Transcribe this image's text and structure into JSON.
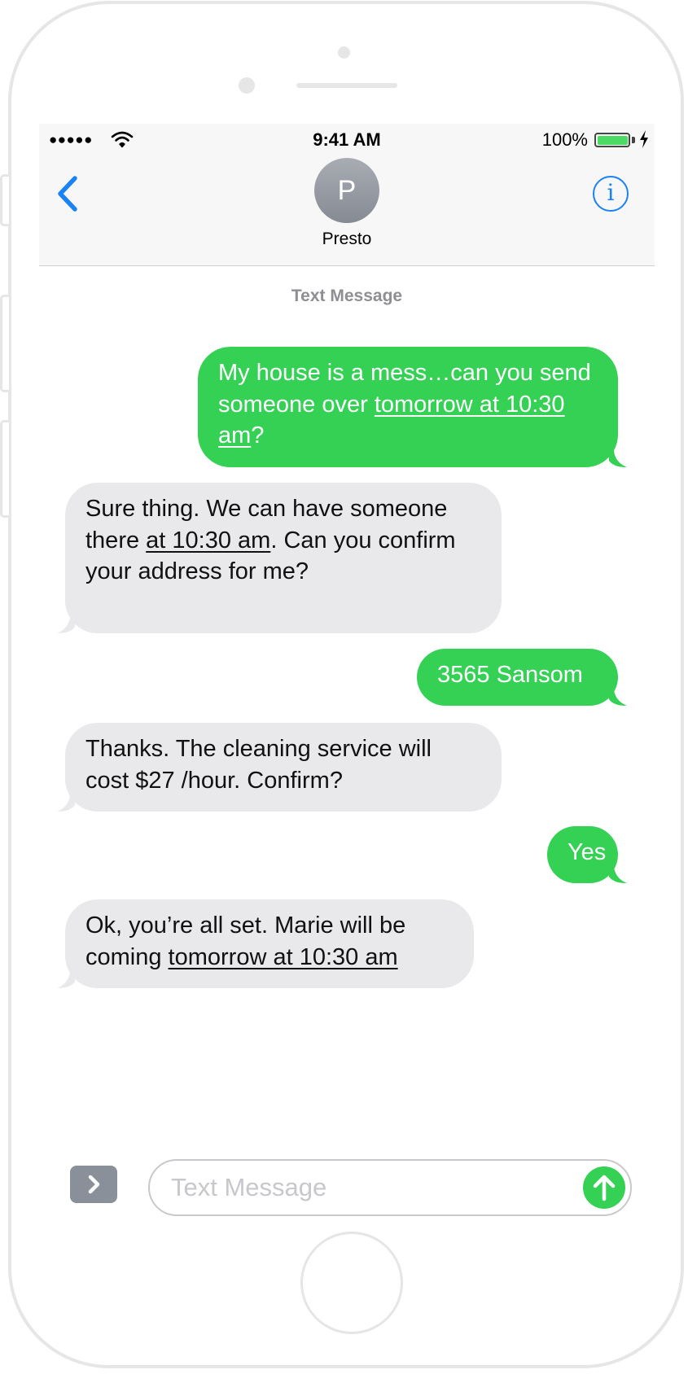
{
  "status_bar": {
    "signal": "●●●●●",
    "time": "9:41 AM",
    "battery": "100%",
    "signal_icon": "signal-dots-icon",
    "wifi_icon": "wifi-icon",
    "battery_icon": "battery-full-icon",
    "charging_icon": "charging-bolt-icon"
  },
  "header": {
    "back_icon": "chevron-left-icon",
    "avatar_initial": "P",
    "contact_name": "Presto",
    "info_icon": "info-circle-icon",
    "info_glyph": "i"
  },
  "thread": {
    "label": "Text Message",
    "messages": [
      {
        "direction": "sent",
        "parts": [
          "My house is a mess…can you send someone over ",
          "tomorrow at 10:30 am",
          "?"
        ],
        "links": [
          1
        ]
      },
      {
        "direction": "received",
        "parts": [
          "Sure thing.  We can have someone there ",
          "at 10:30 am",
          ".  Can you confirm your address for me?"
        ],
        "links": [
          1
        ]
      },
      {
        "direction": "sent",
        "parts": [
          "3565 Sansom"
        ],
        "links": []
      },
      {
        "direction": "received",
        "parts": [
          "Thanks. The cleaning service will cost $27 /hour.  Confirm?"
        ],
        "links": []
      },
      {
        "direction": "sent",
        "parts": [
          "Yes"
        ],
        "links": []
      },
      {
        "direction": "received",
        "parts": [
          "Ok, you’re all set. Marie will be coming ",
          "tomorrow at 10:30 am"
        ],
        "links": [
          1
        ]
      }
    ]
  },
  "composer": {
    "apps_icon": "chevron-right-icon",
    "placeholder": "Text Message",
    "send_icon": "arrow-up-icon"
  },
  "colors": {
    "sent_bubble": "#35d155",
    "received_bubble": "#e9e9ec",
    "accent_blue": "#1a82f7",
    "battery_green": "#4cd964"
  }
}
